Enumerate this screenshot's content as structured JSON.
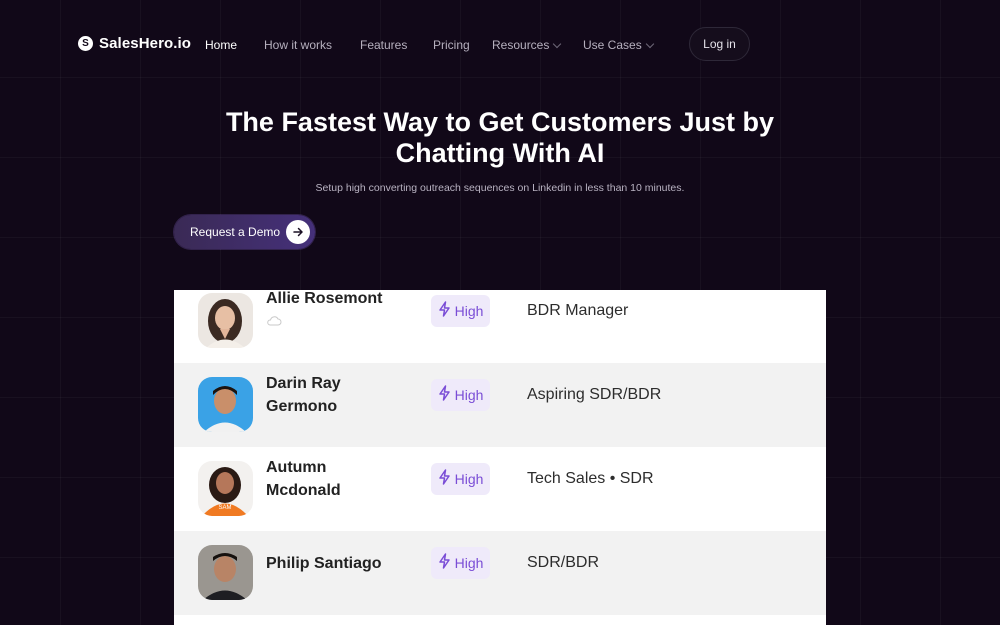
{
  "brand": {
    "name": "SalesHero.io",
    "logo_letter": "S"
  },
  "nav": {
    "items": [
      {
        "label": "Home"
      },
      {
        "label": "How it works"
      },
      {
        "label": "Features"
      },
      {
        "label": "Pricing"
      },
      {
        "label": "Resources"
      },
      {
        "label": "Use Cases"
      }
    ],
    "login": "Log in"
  },
  "hero": {
    "title_line1": "The Fastest Way to Get Customers Just by",
    "title_line2": "Chatting With AI",
    "subtitle": "Setup high converting outreach sequences on Linkedin in less than 10 minutes.",
    "cta": "Request a Demo"
  },
  "leads": [
    {
      "name": "Allie Rosemont",
      "priority": "High",
      "role": "BDR Manager"
    },
    {
      "name": "Darin Ray Germono",
      "priority": "High",
      "role": "Aspiring SDR/BDR"
    },
    {
      "name": "Autumn Mcdonald",
      "priority": "High",
      "role": "Tech Sales • SDR"
    },
    {
      "name": "Philip Santiago",
      "priority": "High",
      "role": "SDR/BDR"
    }
  ],
  "colors": {
    "background": "#110818",
    "accent": "#7a4dd6",
    "badge_bg": "#efeafa"
  }
}
